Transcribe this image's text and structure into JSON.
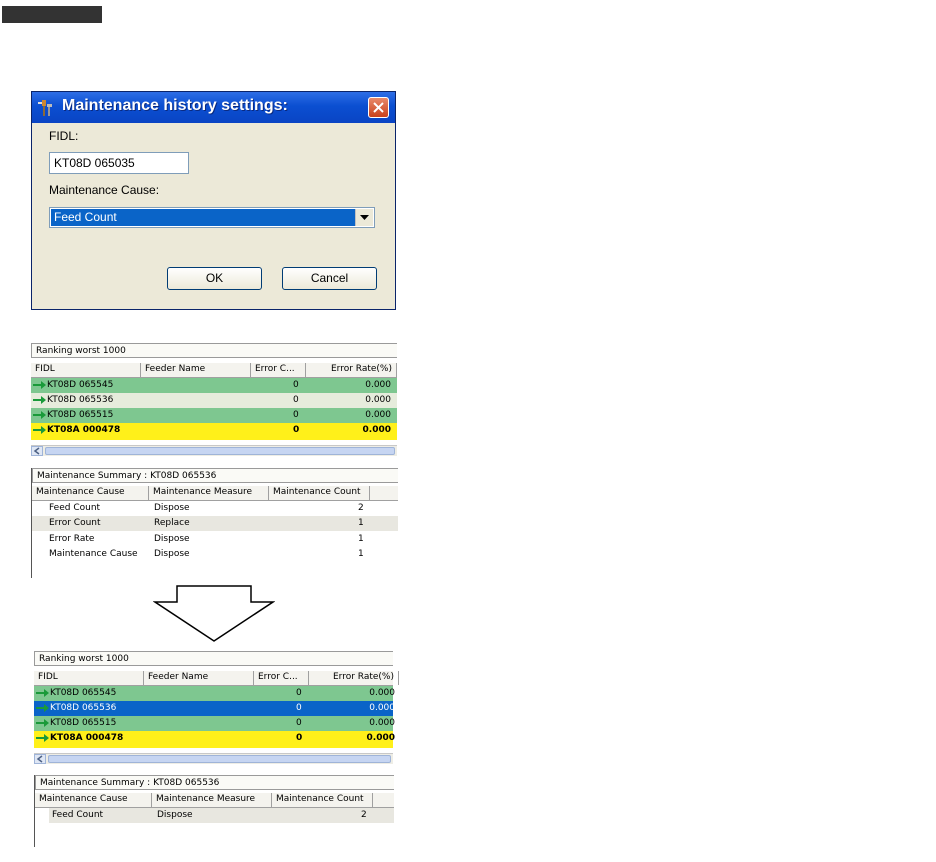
{
  "dialog": {
    "title": "Maintenance history settings:",
    "fidl_label": "FIDL:",
    "fidl_value": "KT08D 065035",
    "cause_label": "Maintenance Cause:",
    "cause_value": "Feed Count",
    "ok_label": "OK",
    "cancel_label": "Cancel"
  },
  "ranking": {
    "title": "Ranking worst 1000",
    "columns": [
      "FIDL",
      "Feeder Name",
      "Error C...",
      "Error Rate(%)"
    ],
    "rows": [
      {
        "fidl": "KT08D 065545",
        "feeder": "",
        "error_count": "0",
        "error_rate": "0.000"
      },
      {
        "fidl": "KT08D 065536",
        "feeder": "",
        "error_count": "0",
        "error_rate": "0.000"
      },
      {
        "fidl": "KT08D 065515",
        "feeder": "",
        "error_count": "0",
        "error_rate": "0.000"
      },
      {
        "fidl": "KT08A 000478",
        "feeder": "",
        "error_count": "0",
        "error_rate": "0.000"
      }
    ]
  },
  "summary": {
    "title": "Maintenance Summary : KT08D 065536",
    "columns": [
      "Maintenance Cause",
      "Maintenance Measure",
      "Maintenance Count"
    ],
    "rows": [
      {
        "cause": "Feed Count",
        "measure": "Dispose",
        "count": "2"
      },
      {
        "cause": "Error Count",
        "measure": "Replace",
        "count": "1"
      },
      {
        "cause": "Error Rate",
        "measure": "Dispose",
        "count": "1"
      },
      {
        "cause": "Maintenance Cause",
        "measure": "Dispose",
        "count": "1"
      }
    ]
  },
  "ranking_after": {
    "title": "Ranking worst 1000",
    "columns": [
      "FIDL",
      "Feeder Name",
      "Error C...",
      "Error Rate(%)"
    ],
    "rows": [
      {
        "fidl": "KT08D 065545",
        "feeder": "",
        "error_count": "0",
        "error_rate": "0.000"
      },
      {
        "fidl": "KT08D 065536",
        "feeder": "",
        "error_count": "0",
        "error_rate": "0.000"
      },
      {
        "fidl": "KT08D 065515",
        "feeder": "",
        "error_count": "0",
        "error_rate": "0.000"
      },
      {
        "fidl": "KT08A 000478",
        "feeder": "",
        "error_count": "0",
        "error_rate": "0.000"
      }
    ]
  },
  "summary_after": {
    "title": "Maintenance Summary : KT08D 065536",
    "columns": [
      "Maintenance Cause",
      "Maintenance Measure",
      "Maintenance Count"
    ],
    "rows": [
      {
        "cause": "Feed Count",
        "measure": "Dispose",
        "count": "2"
      }
    ]
  },
  "colors": {
    "row_green": "#7ec790",
    "row_yellow": "#fff01a",
    "row_selected": "#0a64c8",
    "arrow_green": "#1a9a3a"
  },
  "icons": [
    "tool-icon",
    "close-icon",
    "dropdown-arrow-icon",
    "row-arrow-icon",
    "scroll-left-icon",
    "down-arrow-icon"
  ]
}
